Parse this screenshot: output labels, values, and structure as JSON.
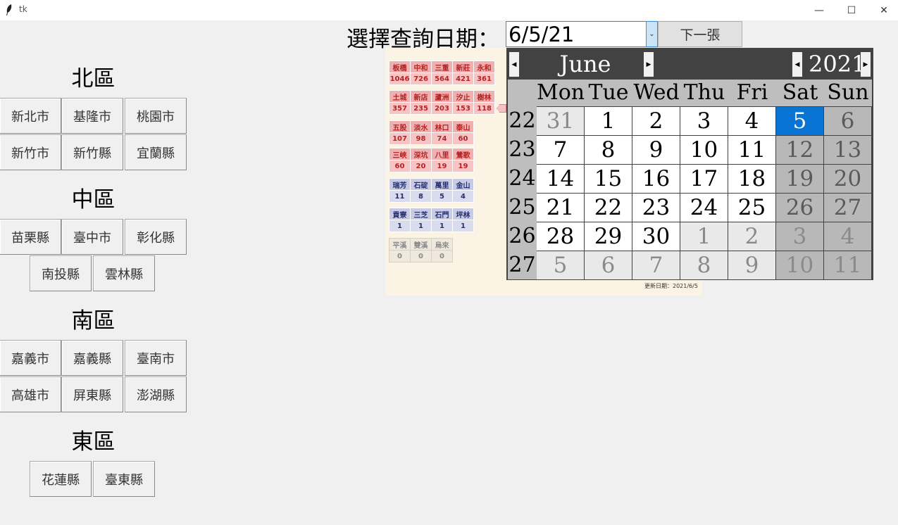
{
  "window": {
    "title": "tk",
    "minimize": "—",
    "maximize": "☐",
    "close": "✕"
  },
  "regions": [
    {
      "title": "北區",
      "buttons": [
        "新北市",
        "基隆市",
        "桃園市",
        "新竹市",
        "新竹縣",
        "宜蘭縣"
      ]
    },
    {
      "title": "中區",
      "buttons": [
        "苗栗縣",
        "臺中市",
        "彰化縣",
        "南投縣",
        "雲林縣"
      ]
    },
    {
      "title": "南區",
      "buttons": [
        "嘉義市",
        "嘉義縣",
        "臺南市",
        "高雄市",
        "屏東縣",
        "澎湖縣"
      ]
    },
    {
      "title": "東區",
      "buttons": [
        "花蓮縣",
        "臺東縣"
      ]
    }
  ],
  "query": {
    "label": "選擇查詢日期：",
    "date_value": "6/5/21",
    "dropdown_icon": "chevron-down-icon",
    "next_button": "下一張"
  },
  "calendar": {
    "month": "June",
    "year": "2021",
    "weekdays": [
      "Mon",
      "Tue",
      "Wed",
      "Thu",
      "Fri",
      "Sat",
      "Sun"
    ],
    "weeks": [
      {
        "week": "22",
        "days": [
          "31",
          "1",
          "2",
          "3",
          "4",
          "5",
          "6"
        ]
      },
      {
        "week": "23",
        "days": [
          "7",
          "8",
          "9",
          "10",
          "11",
          "12",
          "13"
        ]
      },
      {
        "week": "24",
        "days": [
          "14",
          "15",
          "16",
          "17",
          "18",
          "19",
          "20"
        ]
      },
      {
        "week": "25",
        "days": [
          "21",
          "22",
          "23",
          "24",
          "25",
          "26",
          "27"
        ]
      },
      {
        "week": "26",
        "days": [
          "28",
          "29",
          "30",
          "1",
          "2",
          "3",
          "4"
        ]
      },
      {
        "week": "27",
        "days": [
          "5",
          "6",
          "7",
          "8",
          "9",
          "10",
          "11"
        ]
      }
    ],
    "selected": "5",
    "colors": {
      "header": "#424242",
      "selected": "#0a74d4",
      "weekend": "#b8b8b8",
      "other_month": "#e9e9e9"
    }
  },
  "map_image": {
    "tables": [
      {
        "names": [
          "板橋",
          "中和",
          "三重",
          "新莊",
          "永和"
        ],
        "values": [
          "1046",
          "726",
          "564",
          "421",
          "361"
        ]
      },
      {
        "names": [
          "土城",
          "新店",
          "蘆洲",
          "汐止",
          "樹林"
        ],
        "values": [
          "357",
          "235",
          "203",
          "153",
          "118"
        ]
      },
      {
        "names": [
          "五股",
          "淡水",
          "林口",
          "泰山"
        ],
        "values": [
          "107",
          "98",
          "74",
          "60"
        ]
      },
      {
        "names": [
          "三峽",
          "深坑",
          "八里",
          "鶯歌"
        ],
        "values": [
          "60",
          "20",
          "19",
          "19"
        ]
      },
      {
        "names": [
          "瑞芳",
          "石碇",
          "萬里",
          "金山"
        ],
        "values": [
          "11",
          "8",
          "5",
          "4"
        ]
      },
      {
        "names": [
          "貢寮",
          "三芝",
          "石門",
          "坪林"
        ],
        "values": [
          "1",
          "1",
          "1",
          "1"
        ]
      },
      {
        "names": [
          "平溪",
          "雙溪",
          "烏來"
        ],
        "values": [
          "0",
          "0",
          "0"
        ]
      }
    ],
    "update_text": "更新日期：2021/6/5"
  }
}
